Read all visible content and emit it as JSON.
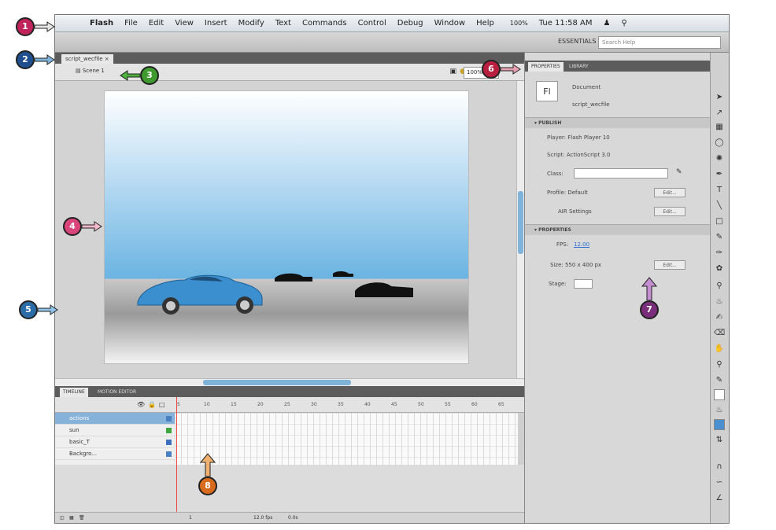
{
  "menubar": {
    "apple": "",
    "items": [
      "Flash",
      "File",
      "Edit",
      "View",
      "Insert",
      "Modify",
      "Text",
      "Commands",
      "Control",
      "Debug",
      "Window",
      "Help"
    ],
    "battery": "100%",
    "clock": "Tue 11:58 AM"
  },
  "topbar": {
    "workspace": "ESSENTIALS ▾",
    "search_placeholder": "Search Help"
  },
  "doc": {
    "tab_label": "script_wecfile",
    "scene_label": "Scene 1",
    "zoom": "100%"
  },
  "timeline": {
    "tabs": [
      "TIMELINE",
      "MOTION EDITOR"
    ],
    "frame_numbers": [
      "5",
      "10",
      "15",
      "20",
      "25",
      "30",
      "35",
      "40",
      "45",
      "50",
      "55",
      "60",
      "65"
    ],
    "layers": [
      {
        "name": "actions",
        "color": "#4a7fc1"
      },
      {
        "name": "sun",
        "color": "#3fa53f"
      },
      {
        "name": "basic_T",
        "color": "#3f6fbf"
      },
      {
        "name": "Backgro...",
        "color": "#4a7fc1"
      }
    ],
    "status": {
      "frame": "1",
      "fps": "12.0 fps",
      "time": "0.0s"
    }
  },
  "properties": {
    "tabs": [
      "PROPERTIES",
      "LIBRARY"
    ],
    "doc_icon": "Fl",
    "doc_type": "Document",
    "doc_name": "script_wecfile",
    "publish": {
      "header": "PUBLISH",
      "player": "Player: Flash Player 10",
      "script": "Script: ActionScript 3.0",
      "class_label": "Class:",
      "profile": "Profile: Default",
      "edit_btn": "Edit...",
      "air": "AIR Settings",
      "air_btn": "Edit..."
    },
    "props": {
      "header": "PROPERTIES",
      "fps_label": "FPS:",
      "fps_value": "12.00",
      "size": "Size: 550 x 400 px",
      "size_btn": "Edit...",
      "stage_label": "Stage:"
    }
  },
  "callouts": [
    {
      "num": "1",
      "color": "#c0245a"
    },
    {
      "num": "2",
      "color": "#1f4f8f"
    },
    {
      "num": "3",
      "color": "#3e9a2e"
    },
    {
      "num": "4",
      "color": "#d9457a"
    },
    {
      "num": "5",
      "color": "#2a6ca8"
    },
    {
      "num": "6",
      "color": "#b81e3e"
    },
    {
      "num": "7",
      "color": "#7a2d7a"
    },
    {
      "num": "8",
      "color": "#d76a1c"
    }
  ],
  "colors": {
    "accent": "#7fb3d9",
    "selection": "#86b1d9",
    "playhead": "#e44444"
  }
}
